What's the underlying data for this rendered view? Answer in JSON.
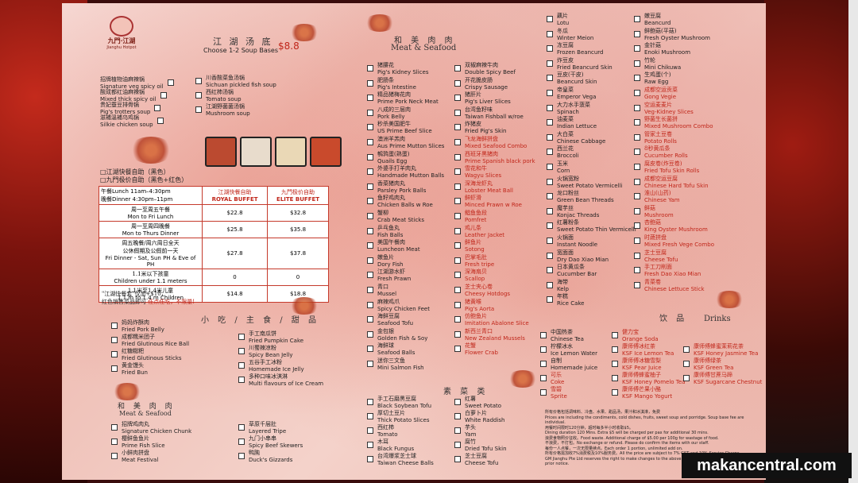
{
  "logo": {
    "zh": "九門·江湖",
    "en": "Jianghu Hotpot"
  },
  "soup": {
    "zh": "江 湖 汤 底",
    "price": "$8.8",
    "sub": "Choose 1-2 Soup Bases"
  },
  "soup_left": [
    [
      "招牌植物油麻辣锅",
      "Signature veg spicy oil"
    ],
    [
      "酸成都红油麻辣锅",
      "Mixed thick spicy oil"
    ],
    [
      "贵妃蚕豆排骨锅",
      "Pig's trotters soup"
    ],
    [
      "滋補溫補乌鸡锅",
      "Silkie chicken soup"
    ]
  ],
  "soup_right": [
    [
      "川香酸菜鱼汤锅",
      "Sichuan pickled fish soup"
    ],
    [
      "西红柿汤锅",
      "Tomato soup"
    ],
    [
      "江湖野菌菌汤锅",
      "Mushroom soup"
    ]
  ],
  "buffet": {
    "l1": "□江湖快餐自助（黑色）",
    "l2": "□九門极价自助（黑色+红色）",
    "lunch": "午餐Lunch 11am–4:30pm",
    "dinner": "晚餐Dinner 4:30pm–11pm",
    "col1": [
      "江湖快餐自助",
      "ROYAL BUFFET"
    ],
    "col2": [
      "九門极价自助",
      "ELITE BUFFET"
    ],
    "rows": [
      [
        "周一至周五午餐",
        "Mon to Fri Lunch",
        "$22.8",
        "$32.8"
      ],
      [
        "周一至周四晚餐",
        "Mon to Thurs Dinner",
        "$25.8",
        "$35.8"
      ],
      [
        "周五晚餐/周六周日全天",
        "公休假期及公假前一天",
        "Fri Dinner - Sat, Sun PH & Eve of PH",
        "$27.8",
        "$37.8"
      ],
      [
        "1.1米以下孩童",
        "Children under 1.1 meters",
        "0",
        "0"
      ],
      [
        "1.1米至1.4米儿童",
        "1.1 m to 1.4 m Children",
        "$14.8",
        "$18.8"
      ]
    ],
    "note1": "\"江湖快餐套\"仅加+$10，",
    "note2": "红色销售菜品即可",
    "note3": "任点任吃，不限量!"
  },
  "snacks": {
    "zh": "小 吃 / 主 食 / 甜 品"
  },
  "snack_left": [
    [
      "妈妈炸酥肉",
      "Fried Pork Belly"
    ],
    [
      "成都糯米团子",
      "Fried Glutinous Rice Ball"
    ],
    [
      "红糖糍粑",
      "Fried Glutinous Sticks"
    ],
    [
      "黄金馒头",
      "Fried Bun"
    ]
  ],
  "snack_right": [
    [
      "手工南瓜饼",
      "Fried Pumpkin Cake"
    ],
    [
      "川蜀辣凉粉",
      "Spicy Bean Jelly"
    ],
    [
      "五谷手工冰粉",
      "Homemade Ice Jelly"
    ],
    [
      "多种口味冰淇淋",
      "Multi flavours of Ice Cream"
    ]
  ],
  "ms1": {
    "zh": "和 美 肉 肉",
    "en": "Meat & Seafood"
  },
  "ms1_left": [
    [
      "招牌鸡肉丸",
      "Signature Chicken Chunk"
    ],
    [
      "樱鲜鱼鱼片",
      "Prime Fish Slice"
    ],
    [
      "小鲜肉拼盘",
      "Meat Festival"
    ]
  ],
  "ms1_right": [
    [
      "草原千层肚",
      "Layered Tripe"
    ],
    [
      "九门小串串",
      "Spicy Beef Skewers"
    ],
    [
      "鸭肫",
      "Duck's Gizzards"
    ]
  ],
  "ms2": {
    "zh": "和 美 肉 肉",
    "en": "Meat & Seafood"
  },
  "col3": [
    [
      "猪腰花",
      "Pig's Kidney Slices",
      0
    ],
    [
      "肥肠条",
      "Pig's Intestine",
      0
    ],
    [
      "精品猪梅花肉",
      "Prime Pork Neck Meat",
      0
    ],
    [
      "八成的三层肉",
      "Pork Belly",
      0
    ],
    [
      "秒杀美国肥牛",
      "US Prime Beef Slice",
      0
    ],
    [
      "澳洲羊羔肉",
      "Aus Prime Mutton Slices",
      0
    ],
    [
      "鹌鹑蛋(熟蛋)",
      "Quails Egg",
      0
    ],
    [
      "外婆手打羊肉丸",
      "Handmade Mutton Balls",
      0
    ],
    [
      "香菜猪肉丸",
      "Parsley Pork Balls",
      0
    ],
    [
      "鱼籽鸡肉丸",
      "Chicken Balls w Roe",
      0
    ],
    [
      "蟹柳",
      "Crab Meat Sticks",
      0
    ],
    [
      "乒乓鱼丸",
      "Fish Balls",
      0
    ],
    [
      "美国午餐肉",
      "Luncheon Meat",
      0
    ],
    [
      "嫩鱼片",
      "Dory Fish",
      0
    ],
    [
      "江湖游水虾",
      "Fresh Prawn",
      0
    ],
    [
      "青口",
      "Mussel",
      0
    ],
    [
      "麻辣鸡爪",
      "Spicy Chicken Feet",
      0
    ],
    [
      "海鲜豆腐",
      "Seafood Tofu",
      0
    ],
    [
      "金包银",
      "Golden Fish & Soy",
      0
    ],
    [
      "海鲜球",
      "Seafood Balls",
      0
    ],
    [
      "迷你三文鱼",
      "Mini Salmon Fish",
      0
    ]
  ],
  "col4": [
    [
      "双椒麻辣牛肉",
      "Double Spicy Beef",
      0
    ],
    [
      "开花脆皮肠",
      "Crispy Sausage",
      0
    ],
    [
      "猪肝片",
      "Pig's Liver Slices",
      0
    ],
    [
      "台湾鱼籽味",
      "Taiwan Fishball w/roe",
      0
    ],
    [
      "炸猪皮",
      "Fried Pig's Skin",
      0
    ],
    [
      "飞龙海鲜拼盘",
      "Mixed Seafood Combo",
      1
    ],
    [
      "西班牙黑猪肉",
      "Prime Spanish black pork",
      1
    ],
    [
      "雪花和牛",
      "Wagyu Slices",
      1
    ],
    [
      "深海龙虾丸",
      "Lobster Meat Ball",
      1
    ],
    [
      "鲜虾滑",
      "Minced Prawn w Roe",
      1
    ],
    [
      "鲳鱼鱼段",
      "Pomfret",
      1
    ],
    [
      "鸡儿条",
      "Leather Jacket",
      1
    ],
    [
      "鲜鱼片",
      "Sotong",
      1
    ],
    [
      "巴掌毛肚",
      "Fresh tripe",
      1
    ],
    [
      "深海扇贝",
      "Scallop",
      1
    ],
    [
      "芝士夹心卷",
      "Cheesy Hotdogs",
      1
    ],
    [
      "猪黄喉",
      "Pig's Aorta",
      1
    ],
    [
      "仿鲍鱼片",
      "Imitation Abalone Slice",
      1
    ],
    [
      "新西兰青口",
      "New Zealand Mussels",
      1
    ],
    [
      "花蟹",
      "Flower Crab",
      1
    ]
  ],
  "veg": {
    "zh": "素 菜 类"
  },
  "veg_left": [
    [
      "手工石磨黑豆腐",
      "Black Soybean Tofu"
    ],
    [
      "厚切土豆片",
      "Thick Potato Slices"
    ],
    [
      "西红柿",
      "Tomato"
    ],
    [
      "木耳",
      "Black Fungus"
    ],
    [
      "台湾爆浆芝士球",
      "Taiwan Cheese Balls"
    ]
  ],
  "veg_right": [
    [
      "红薯",
      "Sweet Potato"
    ],
    [
      "白萝卜片",
      "White Raddish"
    ],
    [
      "芋头",
      "Yam"
    ],
    [
      "腐竹",
      "Dried Tofu Skin"
    ],
    [
      "芝士豆腐",
      "Cheese Tofu"
    ]
  ],
  "col5": [
    [
      "藕片",
      "Lotu",
      0
    ],
    [
      "冬瓜",
      "Winter Meion",
      0
    ],
    [
      "冻豆腐",
      "Frozen Beancurd",
      0
    ],
    [
      "炸豆皮",
      "Fried Beancurd Skin",
      0
    ],
    [
      "豆皮(干皮)",
      "Beancurd Skin",
      0
    ],
    [
      "帝皇菜",
      "Emperor Vega",
      0
    ],
    [
      "大力水手菠菜",
      "Spinach",
      0
    ],
    [
      "油麦菜",
      "Indian Lettuce",
      0
    ],
    [
      "大白菜",
      "Chinese Cabbage",
      0
    ],
    [
      "西兰花",
      "Broccoli",
      0
    ],
    [
      "玉米",
      "Corn",
      0
    ],
    [
      "火锅宽粉",
      "Sweet Potato Vermicelli",
      0
    ],
    [
      "龙口粉丝",
      "Green Bean Threads",
      0
    ],
    [
      "魔芋丝",
      "Konjac Threads",
      0
    ],
    [
      "红薯粉条",
      "Sweet Potato Thin Vermicelli",
      0
    ],
    [
      "火锅面",
      "Instant Noodle",
      0
    ],
    [
      "宽面面",
      "Dry Dao Xiao Mian",
      0
    ],
    [
      "日本黄瓜条",
      "Cucumber Bar",
      0
    ],
    [
      "海带",
      "Kelp",
      0
    ],
    [
      "年糕",
      "Rice Cake",
      0
    ]
  ],
  "col6": [
    [
      "嫩豆腐",
      "Beancurd",
      0
    ],
    [
      "鲜鲍菇(平菇)",
      "Fresh Oyster Mushroom",
      0
    ],
    [
      "金针菇",
      "Enoki Mushroom",
      0
    ],
    [
      "竹轮",
      "Mini Chikuwa",
      0
    ],
    [
      "生鸡蛋(个)",
      "Raw Egg",
      0
    ],
    [
      "成都空运贡菜",
      "Gong Vegie",
      1
    ],
    [
      "空运麦麦片",
      "Veg-Kidney Slices",
      1
    ],
    [
      "野菌生长菌拼",
      "Mixed Mushroom Combo",
      1
    ],
    [
      "管家土豆卷",
      "Potato Rolls",
      1
    ],
    [
      "8秒黄瓜条",
      "Cucumber Rolls",
      1
    ],
    [
      "腐皮卷(炸豆卷)",
      "Fried Tofu Skin Rolls",
      1
    ],
    [
      "成都空运豆腐",
      "Chinese Hard Tofu Skin",
      1
    ],
    [
      "淮山(山药)",
      "Chinese Yam",
      1
    ],
    [
      "鲜菇",
      "Mushroom",
      1
    ],
    [
      "杏鲍菇",
      "King Oyster Mushroom",
      1
    ],
    [
      "时蔬拼盘",
      "Mixed Fresh Vege Combo",
      1
    ],
    [
      "芝士豆腐",
      "Cheese Tofu",
      1
    ],
    [
      "手工刀削面",
      "Fresh Dao Xiao Mian",
      1
    ],
    [
      "青菜卷",
      "Chinese Lettuce Stick",
      1
    ]
  ],
  "drinks": {
    "zh": "饮 品",
    "en": "Drinks"
  },
  "drinks_a": [
    [
      "中国热茶",
      "Chinese Tea",
      0
    ],
    [
      "柠檬冰水",
      "Ice Lemon Water",
      0
    ],
    [
      "自制",
      "Homemade juice",
      0
    ],
    [
      "可乐",
      "Coke",
      1
    ],
    [
      "雪碧",
      "Sprite",
      1
    ]
  ],
  "drinks_b": [
    [
      "健力宝",
      "Orange Soda",
      1
    ],
    [
      "康师傅冰红茶",
      "KSF Ice Lemon Tea",
      1
    ],
    [
      "康师傅冰糖雪梨",
      "KSF Pear Juice",
      1
    ],
    [
      "康师傅蜂蜜柚子",
      "KSF Honey Pomelo Tea",
      1
    ],
    [
      "康师傅芒果小酪",
      "KSF Mango Yogurt",
      1
    ]
  ],
  "drinks_c": [
    [
      "康师傅蜂蜜茉莉花茶",
      "KSF Honey Jasmine Tea",
      1
    ],
    [
      "康师傅绿茶",
      "KSF Green Tea",
      1
    ],
    [
      "康师傅甘蔗马蹄",
      "KSF Sugarcane Chestnut",
      1
    ]
  ],
  "terms": [
    "所有价格包括调味料、冷盘、水果、甜品汤，果汁和冰淇淋，免费",
    "Prices are including the condiments, cold dishes, fruits, sweet soup and porridge. Soup base fee are individual.",
    "用餐时间限时120分钟，超时每多半小时收取$5。",
    "Dining duration 120 Mins. Extra $5 will be charged per pax for additional 30 mins.",
    "浪费食物照价征收。Food waste. Additional charge of $5.00 per 100g for wastage of food.",
    "不浪费，不打包。No exchange or refund. Please do confirm the items with our staff.",
    "每份一人点餐，一次无限量续点。Each order 1 portion, unlimited add on.",
    "所有价格需加收7%消费税及10%服务费。All the price are subject to 7% GST and 10% Service Charge.",
    "GM Jianghu Pte Ltd reserves the right to make changes to the above Terms and Conditions without any prior notice."
  ],
  "watermark": "makancentral.com"
}
